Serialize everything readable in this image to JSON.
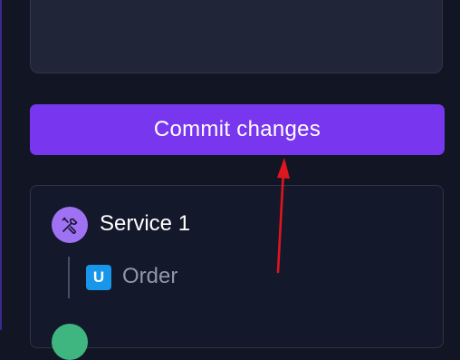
{
  "commit": {
    "label": "Commit changes"
  },
  "services": [
    {
      "name": "Service 1",
      "icon": "tools-icon",
      "avatar_color": "#9e72f3",
      "children": [
        {
          "badge": "U",
          "badge_color": "#1796ea",
          "label": "Order"
        }
      ]
    }
  ],
  "colors": {
    "background": "#121624",
    "accent": "#7836ee",
    "annotation_arrow": "#e0161f"
  }
}
